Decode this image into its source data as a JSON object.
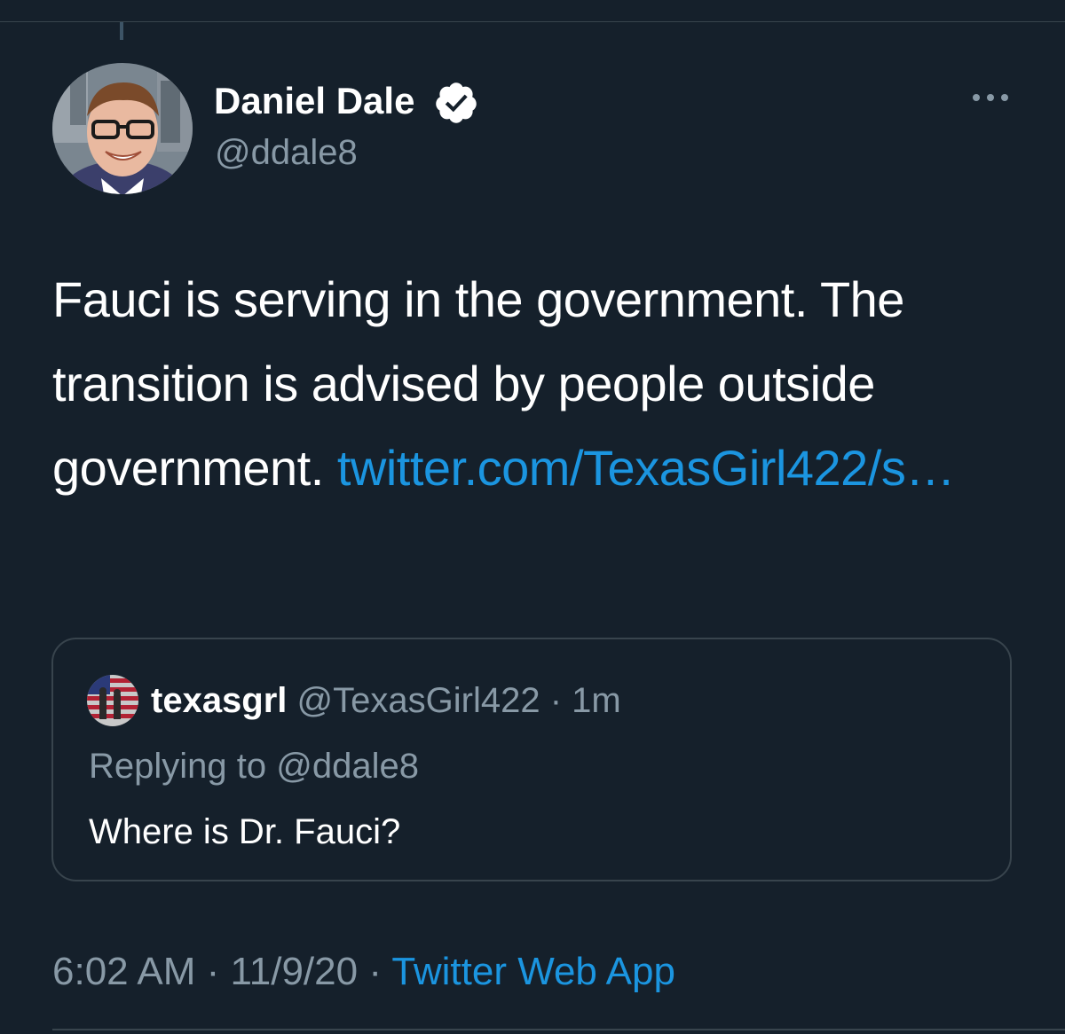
{
  "author": {
    "display_name": "Daniel Dale",
    "handle": "@ddale8",
    "verified": true
  },
  "tweet": {
    "text_before_link": "Fauci is serving in the government. The transition is advised by people outside government. ",
    "link_text": "twitter.com/TexasGirl422/s…"
  },
  "quoted_tweet": {
    "display_name": "texasgrl",
    "handle": "@TexasGirl422",
    "separator": " · ",
    "time_ago": "1m",
    "replying_to": "Replying to @ddale8",
    "text": "Where is Dr. Fauci?"
  },
  "footer": {
    "time": "6:02 AM",
    "separator_1": " · ",
    "date": "11/9/20",
    "separator_2": " · ",
    "source": "Twitter Web App"
  },
  "icons": {
    "verified": "verified-badge-icon",
    "more": "more-options-icon"
  },
  "colors": {
    "background": "#15202b",
    "primary_text": "#ffffff",
    "secondary_text": "#8899a6",
    "link": "#1b95e0",
    "border": "#38444d"
  }
}
